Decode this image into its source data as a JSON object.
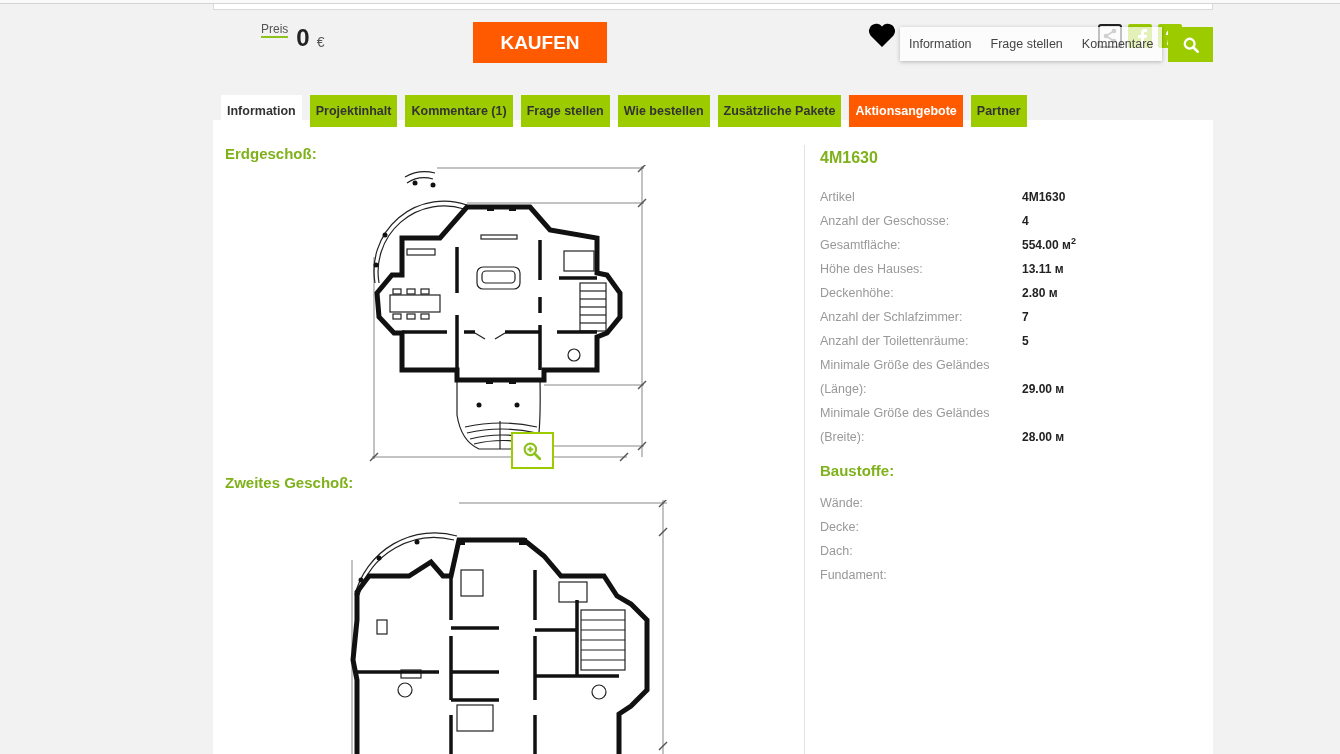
{
  "header": {
    "price": {
      "label": "Preis",
      "amount": "0",
      "currency": "€"
    },
    "buy_button": "KAUFEN",
    "nav_menu": [
      "Information",
      "Frage stellen",
      "Kommentare"
    ]
  },
  "tabs": [
    {
      "label": "Information",
      "selected": true,
      "kind": "normal"
    },
    {
      "label": "Projektinhalt",
      "selected": false,
      "kind": "normal"
    },
    {
      "label": "Kommentare (1)",
      "selected": false,
      "kind": "normal"
    },
    {
      "label": "Frage stellen",
      "selected": false,
      "kind": "normal"
    },
    {
      "label": "Wie bestellen",
      "selected": false,
      "kind": "normal"
    },
    {
      "label": "Zusätzliche Pakete",
      "selected": false,
      "kind": "normal"
    },
    {
      "label": "Aktionsangebote",
      "selected": false,
      "kind": "promo"
    },
    {
      "label": "Partner",
      "selected": false,
      "kind": "normal"
    }
  ],
  "floors": [
    {
      "title": "Erdgeschoß:",
      "kind": "ground",
      "zoom_button": true
    },
    {
      "title": "Zweites Geschoß:",
      "kind": "upper",
      "zoom_button": false
    }
  ],
  "details": {
    "title": "4M1630",
    "specs": [
      {
        "label": "Artikel",
        "value": "4M1630"
      },
      {
        "label": "Anzahl der Geschosse:",
        "value": "4"
      },
      {
        "label": "Gesamtfläche:",
        "value": "554.00 м$^{2}$"
      },
      {
        "label": "Höhe des Hauses:",
        "value": "13.11 м"
      },
      {
        "label": "Deckenhöhe:",
        "value": "2.80 м"
      },
      {
        "label": "Anzahl der Schlafzimmer:",
        "value": "7"
      },
      {
        "label": "Anzahl der Toilettenräume:",
        "value": "5"
      },
      {
        "label": "Minimale Größe des Geländes (Länge):",
        "value": "29.00 м"
      },
      {
        "label": "Minimale Größe des Geländes (Breite):",
        "value": "28.00 м"
      }
    ]
  },
  "materials": {
    "title": "Baustoffe:",
    "items": [
      "Wände:",
      "Decke:",
      "Dach:",
      "Fundament:"
    ]
  }
}
